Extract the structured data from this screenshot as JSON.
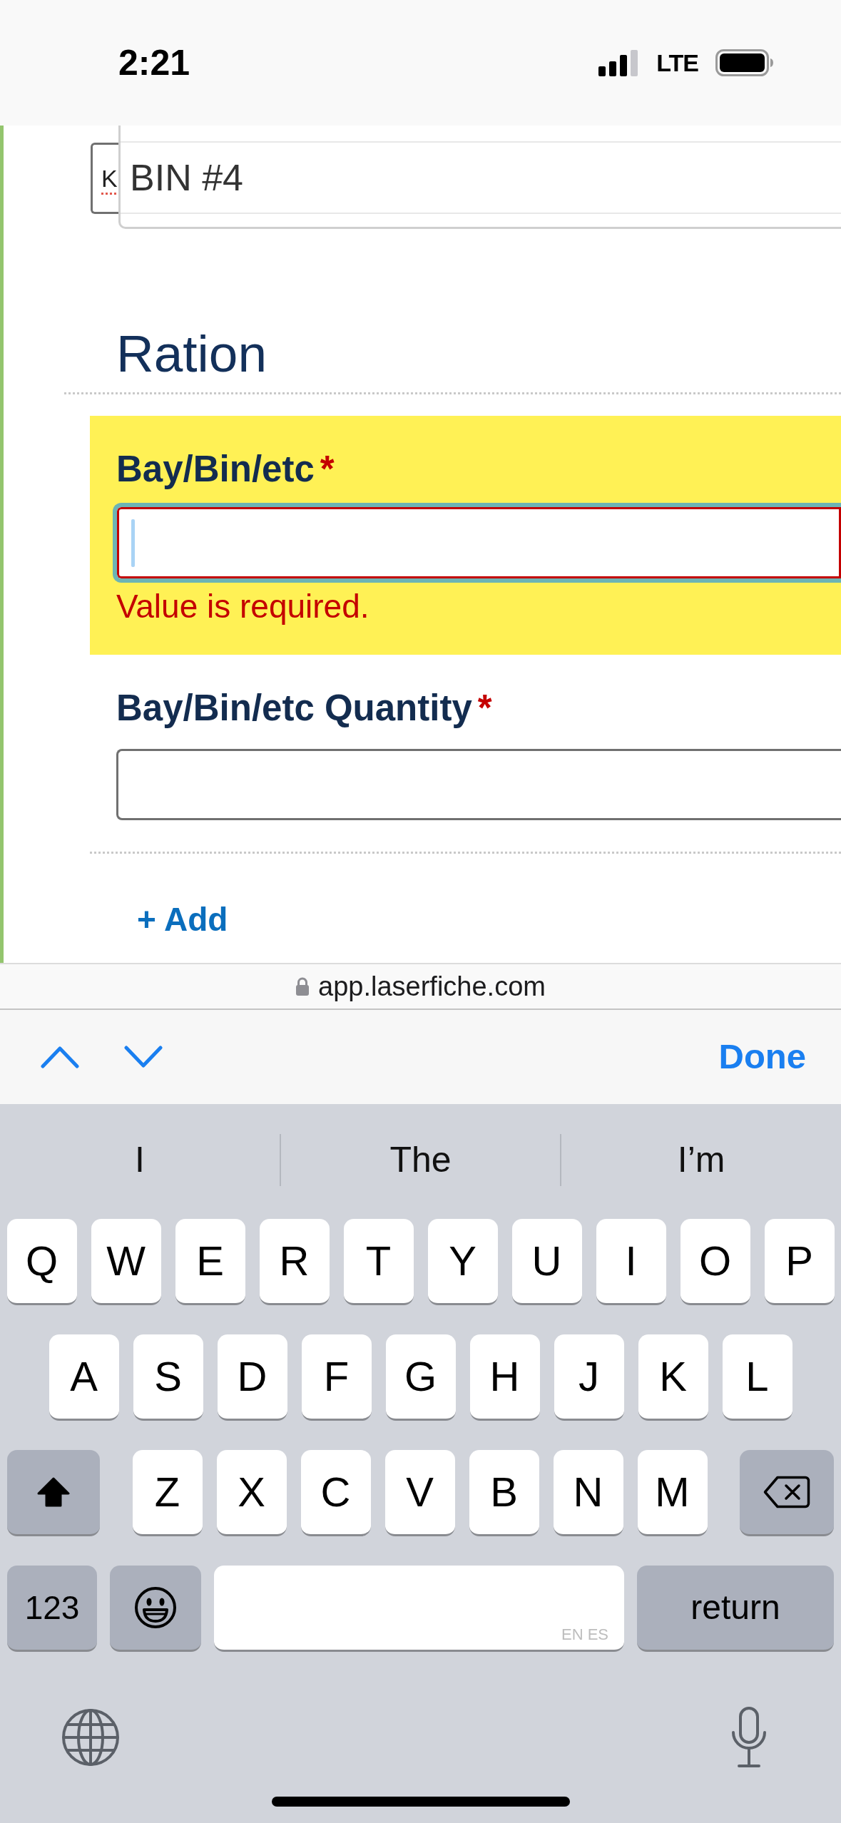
{
  "status_bar": {
    "time": "2:21",
    "network": "LTE"
  },
  "page": {
    "lookup_field": {
      "value": "K"
    },
    "dropdown": {
      "items": [
        {
          "label": "BIN #4",
          "selected": false
        }
      ]
    },
    "section": {
      "title": "Ration",
      "fields": [
        {
          "label": "Bay/Bin/etc",
          "required_mark": "*",
          "focused": true,
          "invalid": true,
          "error": "Value is required."
        },
        {
          "label": "Bay/Bin/etc Quantity",
          "required_mark": "*",
          "focused": false,
          "invalid": false
        }
      ],
      "add_link": "+ Add"
    }
  },
  "address_bar": {
    "url": "app.laserfiche.com"
  },
  "form_toolbar": {
    "done": "Done"
  },
  "keyboard": {
    "suggestions": [
      "I",
      "The",
      "I’m"
    ],
    "rows": [
      [
        "Q",
        "W",
        "E",
        "R",
        "T",
        "Y",
        "U",
        "I",
        "O",
        "P"
      ],
      [
        "A",
        "S",
        "D",
        "F",
        "G",
        "H",
        "J",
        "K",
        "L"
      ],
      [
        "Z",
        "X",
        "C",
        "V",
        "B",
        "N",
        "M"
      ]
    ],
    "shift_on": true,
    "numbers_key": "123",
    "space_label": "EN ES",
    "return_key": "return"
  }
}
